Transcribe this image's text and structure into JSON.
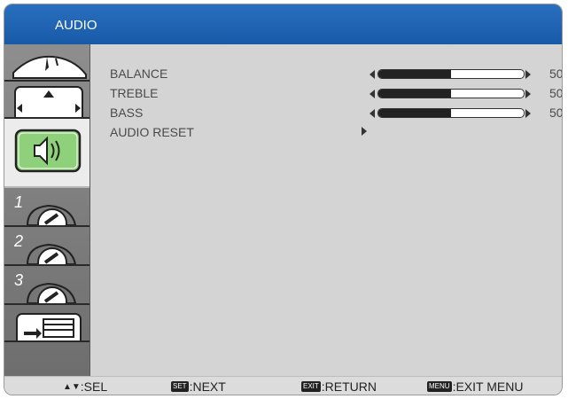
{
  "header": {
    "title": "AUDIO"
  },
  "sidebar": {
    "items": [
      {
        "icon": "picture-icon"
      },
      {
        "icon": "screen-adjust-icon"
      },
      {
        "icon": "audio-speaker-icon",
        "active": true
      },
      {
        "icon": "config1-gear-icon",
        "number": "1"
      },
      {
        "icon": "config2-gear-icon",
        "number": "2"
      },
      {
        "icon": "config3-gear-icon",
        "number": "3"
      },
      {
        "icon": "advanced-option-icon"
      }
    ]
  },
  "audio": {
    "rows": [
      {
        "label": "BALANCE",
        "value": "50",
        "level": 0.5
      },
      {
        "label": "TREBLE",
        "value": "50",
        "level": 0.5
      },
      {
        "label": "BASS",
        "value": "50",
        "level": 0.5
      }
    ],
    "reset_label": "AUDIO RESET"
  },
  "footer": {
    "sel_text": ":SEL",
    "next_key": "SET",
    "next_text": ":NEXT",
    "return_key": "EXIT",
    "return_text": ":RETURN",
    "menu_key": "MENU",
    "menu_text": ":EXIT MENU"
  },
  "colors": {
    "header": "#1f64b3",
    "panel": "#d4d4d4",
    "accent_green": "#3a9a2c"
  }
}
